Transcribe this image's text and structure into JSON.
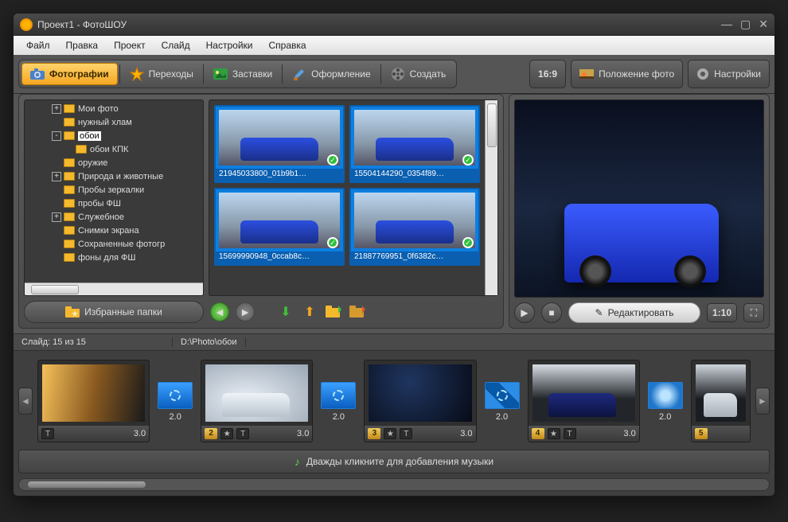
{
  "window": {
    "title": "Проект1 - ФотоШОУ"
  },
  "menu": [
    "Файл",
    "Правка",
    "Проект",
    "Слайд",
    "Настройки",
    "Справка"
  ],
  "tabs": [
    {
      "id": "photos",
      "label": "Фотографии",
      "active": true
    },
    {
      "id": "transitions",
      "label": "Переходы"
    },
    {
      "id": "titles",
      "label": "Заставки"
    },
    {
      "id": "design",
      "label": "Оформление"
    },
    {
      "id": "create",
      "label": "Создать"
    }
  ],
  "rightTools": {
    "aspect": "16:9",
    "position": "Положение фото",
    "settings": "Настройки"
  },
  "tree": {
    "items": [
      {
        "depth": 2,
        "pm": "+",
        "label": "Мои фото"
      },
      {
        "depth": 2,
        "pm": "",
        "label": "нужный хлам"
      },
      {
        "depth": 2,
        "pm": "-",
        "label": "обои",
        "selected": true
      },
      {
        "depth": 3,
        "pm": "",
        "label": "обои КПК"
      },
      {
        "depth": 2,
        "pm": "",
        "label": "оружие"
      },
      {
        "depth": 2,
        "pm": "+",
        "label": "Природа и животные"
      },
      {
        "depth": 2,
        "pm": "",
        "label": "Пробы зеркалки"
      },
      {
        "depth": 2,
        "pm": "",
        "label": "пробы ФШ"
      },
      {
        "depth": 2,
        "pm": "+",
        "label": "Служебное"
      },
      {
        "depth": 2,
        "pm": "",
        "label": "Снимки экрана"
      },
      {
        "depth": 2,
        "pm": "",
        "label": "Сохраненные фотогр"
      },
      {
        "depth": 2,
        "pm": "",
        "label": "фоны для ФШ"
      }
    ]
  },
  "thumbs": [
    {
      "name": "21945033800_01b9b1…"
    },
    {
      "name": "15504144290_0354f89…"
    },
    {
      "name": "15699990948_0ccab8c…"
    },
    {
      "name": "21887769951_0f6382c…"
    }
  ],
  "favButton": "Избранные папки",
  "preview": {
    "editLabel": "Редактировать",
    "time": "1:10"
  },
  "status": {
    "slide": "Слайд: 15 из 15",
    "path": "D:\\Photo\\обои"
  },
  "timeline": {
    "slides": [
      {
        "num": "",
        "dur": "3.0",
        "imgCls": "s1",
        "chips": [
          "T"
        ]
      },
      {
        "num": "2",
        "dur": "3.0",
        "imgCls": "s2",
        "chips": [
          "★",
          "T"
        ],
        "car": true
      },
      {
        "num": "3",
        "dur": "3.0",
        "imgCls": "s3",
        "chips": [
          "★",
          "T"
        ]
      },
      {
        "num": "4",
        "dur": "3.0",
        "imgCls": "s4",
        "chips": [
          "★",
          "T"
        ],
        "car": true
      },
      {
        "num": "5",
        "dur": "",
        "imgCls": "s5",
        "chips": [],
        "car": true,
        "partial": true
      }
    ],
    "transitions": [
      {
        "dur": "2.0",
        "cls": ""
      },
      {
        "dur": "2.0",
        "cls": ""
      },
      {
        "dur": "2.0",
        "cls": "sw"
      },
      {
        "dur": "2.0",
        "cls": "sp"
      }
    ],
    "musicHint": "Дважды кликните для добавления музыки"
  }
}
